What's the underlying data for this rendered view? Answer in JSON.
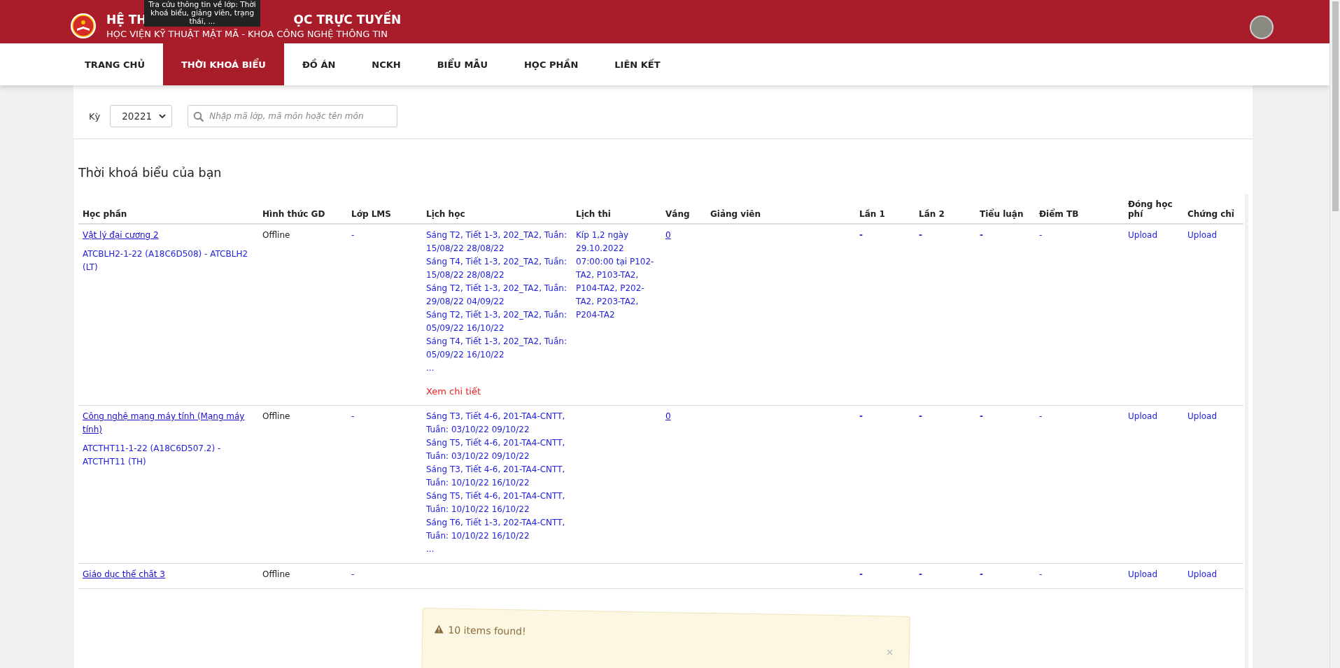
{
  "header": {
    "title_start": "HỆ TH",
    "title_end": "ỌC TRỰC TUYẾN",
    "subtitle": "HỌC VIỆN KỸ THUẬT MẬT MÃ - KHOA CÔNG NGHỆ THÔNG TIN"
  },
  "tooltip": "Tra cứu thông tin về lớp: Thời khoá biểu, giảng viên, trạng thái, ...",
  "nav": [
    {
      "label": "TRANG CHỦ",
      "selected": false
    },
    {
      "label": "THỜI KHOÁ BIỂU",
      "selected": true
    },
    {
      "label": "ĐỒ ÁN",
      "selected": false
    },
    {
      "label": "NCKH",
      "selected": false
    },
    {
      "label": "BIỂU MẪU",
      "selected": false
    },
    {
      "label": "HỌC PHẦN",
      "selected": false
    },
    {
      "label": "LIÊN KẾT",
      "selected": false
    }
  ],
  "filter": {
    "term_label": "Kỳ",
    "term_value": "20221",
    "search_placeholder": "Nhập mã lớp, mã môn hoặc tên môn"
  },
  "section_title": "Thời khoá biểu của bạn",
  "table": {
    "columns": [
      "Học phần",
      "Hình thức GD",
      "Lớp LMS",
      "Lịch học",
      "Lịch thi",
      "Vắng",
      "Giảng viên",
      "Lần 1",
      "Lần 2",
      "Tiểu luận",
      "Điểm TB",
      "Đóng học phí",
      "Chứng chỉ"
    ],
    "rows": [
      {
        "course": "Vật lý đại cương 2",
        "class_code": "ATCBLH2-1-22 (A18C6D508) - ATCBLH2 (LT)",
        "mode": "Offline",
        "lms": "-",
        "schedule": [
          "Sáng T2, Tiết 1-3, 202_TA2, Tuần: 15/08/22 28/08/22",
          "Sáng T4, Tiết 1-3, 202_TA2, Tuần: 15/08/22 28/08/22",
          "Sáng T2, Tiết 1-3, 202_TA2, Tuần: 29/08/22 04/09/22",
          "Sáng T2, Tiết 1-3, 202_TA2, Tuần: 05/09/22 16/10/22",
          "Sáng T4, Tiết 1-3, 202_TA2, Tuần: 05/09/22 16/10/22"
        ],
        "schedule_more": "...",
        "detail_link": "Xem chi tiết",
        "exam": "Kíp 1,2 ngày 29.10.2022 07:00:00 tại P102-TA2, P103-TA2, P104-TA2, P202-TA2, P203-TA2, P204-TA2",
        "absent": "0",
        "attempt_1": "-",
        "attempt_2": "-",
        "essay": "-",
        "average": "-",
        "fee": "Upload",
        "certificate": "Upload"
      },
      {
        "course": "Công nghệ mạng máy tính (Mạng máy tính)",
        "class_code": "ATCTHT11-1-22 (A18C6D507.2) - ATCTHT11 (TH)",
        "mode": "Offline",
        "lms": "-",
        "schedule": [
          "Sáng T3, Tiết 4-6, 201-TA4-CNTT, Tuần: 03/10/22 09/10/22",
          "Sáng T5, Tiết 4-6, 201-TA4-CNTT, Tuần: 03/10/22 09/10/22",
          "Sáng T3, Tiết 4-6, 201-TA4-CNTT, Tuần: 10/10/22 16/10/22",
          "Sáng T5, Tiết 4-6, 201-TA4-CNTT, Tuần: 10/10/22 16/10/22",
          "Sáng T6, Tiết 1-3, 202-TA4-CNTT, Tuần: 10/10/22 16/10/22"
        ],
        "schedule_more": "...",
        "absent": "0",
        "attempt_1": "-",
        "attempt_2": "-",
        "essay": "-",
        "average": "-",
        "fee": "Upload",
        "certificate": "Upload"
      },
      {
        "course": "Giáo dục thể chất 3",
        "mode": "Offline",
        "lms": "-",
        "attempt_1": "-",
        "attempt_2": "-",
        "essay": "-",
        "average": "-",
        "fee": "Upload",
        "certificate": "Upload"
      }
    ]
  },
  "toast": {
    "message": "10 items found!",
    "close": "×"
  }
}
